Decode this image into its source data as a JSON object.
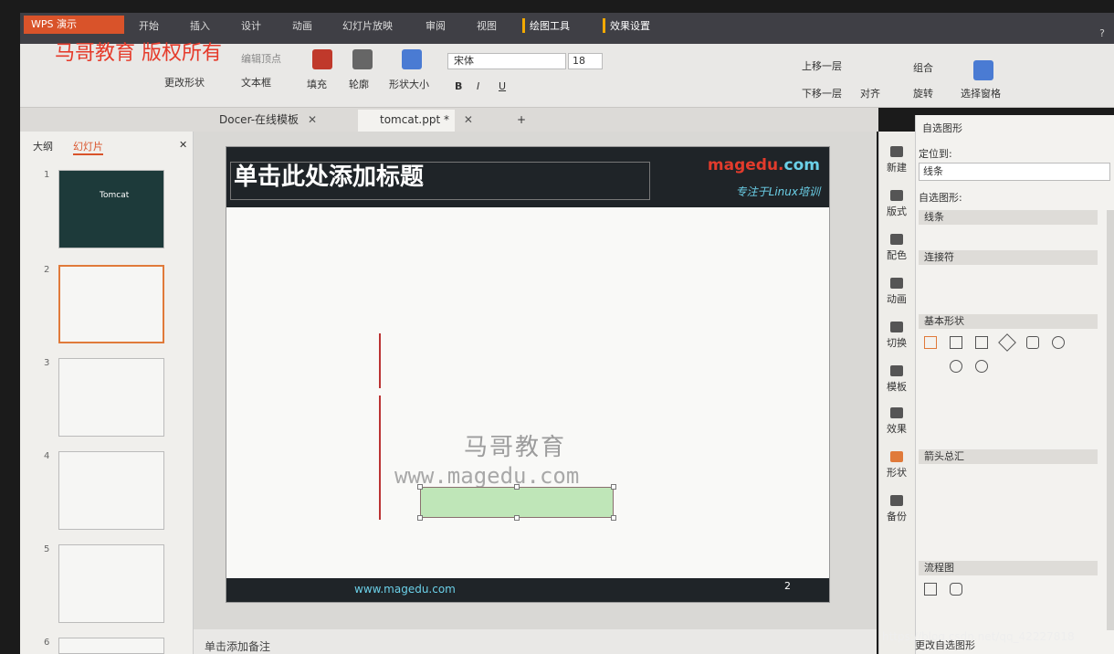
{
  "app": {
    "wps_button": "WPS 演示"
  },
  "menu": [
    "开始",
    "插入",
    "设计",
    "动画",
    "幻灯片放映",
    "审阅",
    "视图",
    "绘图工具",
    "效果设置"
  ],
  "active_menu": "绘图工具",
  "topright": "?",
  "watermark_top": "马哥教育 版权所有",
  "ribbon": {
    "change_shape": "更改形状",
    "text_box": "文本框",
    "edit_vertex": "编辑顶点",
    "fill": "填充",
    "outline": "轮廓",
    "shape_size": "形状大小",
    "font_name": "宋体",
    "font_size": "18",
    "bring_forward": "上移一层",
    "send_backward": "下移一层",
    "align": "对齐",
    "group": "组合",
    "rotate": "旋转",
    "select_pane": "选择窗格"
  },
  "tabs": [
    {
      "label": "Docer-在线模板"
    },
    {
      "label": "tomcat.ppt *"
    }
  ],
  "left_tabs": {
    "outline": "大纲",
    "slides": "幻灯片"
  },
  "thumbnails": [
    "1",
    "2",
    "3",
    "4",
    "5",
    "6"
  ],
  "thumb1_title": "Tomcat",
  "slide": {
    "title": "单击此处添加标题",
    "logo_main": "magedu.",
    "logo_com": "com",
    "logo_sub": "专注于Linux培训",
    "footer_url": "www.magedu.com",
    "page_num": "2",
    "wm1": "马哥教育",
    "wm2": "www.magedu.com"
  },
  "notes": "单击添加备注",
  "sidebar": [
    "新建",
    "版式",
    "配色",
    "动画",
    "切换",
    "模板",
    "效果",
    "形状",
    "备份"
  ],
  "panel": {
    "title": "自选图形",
    "locate": "定位到:",
    "locate_value": "线条",
    "autoshape": "自选图形:",
    "sections": [
      "线条",
      "连接符",
      "基本形状",
      "箭头总汇",
      "流程图"
    ],
    "more": "更改自选图形"
  },
  "overlay_url": "https://blog.csdn.net/qq_42227818"
}
